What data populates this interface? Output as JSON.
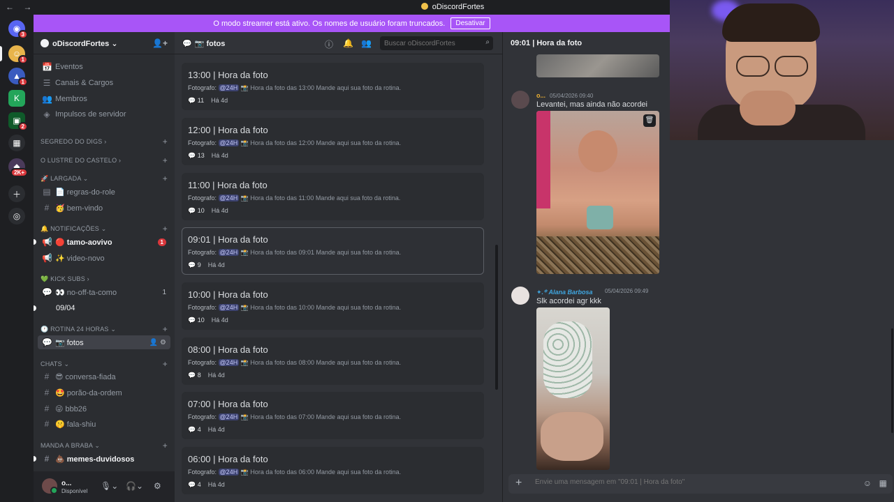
{
  "window": {
    "title": "oDiscordFortes",
    "back": "←",
    "forward": "→"
  },
  "banner": {
    "text": "O modo streamer está ativo. Os nomes de usuário foram truncados.",
    "button": "Desativar"
  },
  "servers": [
    {
      "badge": "3"
    },
    {
      "badge": "1"
    },
    {
      "badge": "1"
    },
    {
      "badge": ""
    },
    {
      "badge": "2"
    },
    {
      "badge": ""
    },
    {
      "badge": "2K+"
    }
  ],
  "sidebar": {
    "server_name": "oDiscordFortes",
    "items": [
      {
        "label": "Eventos",
        "icon": "📅"
      },
      {
        "label": "Canais & Cargos",
        "icon": "☰"
      },
      {
        "label": "Membros",
        "icon": "👥"
      },
      {
        "label": "Impulsos de servidor",
        "icon": "◈"
      }
    ],
    "categories": {
      "c1": "SEGREDO DO DIGS",
      "c2": "O LUSTRE DO CASTELO",
      "c3": "🚀 LARGADA",
      "c4": "🔔 NOTIFICAÇÕES",
      "c5": "💚 KICK SUBS",
      "c6": "🕐 ROTINA 24 HORAS",
      "c7": "CHATS",
      "c8": "MANDA A BRABA"
    },
    "channels": {
      "regras": "📄 regras-do-role",
      "bemvindo": "🥳 bem-vindo",
      "tamo": "🔴 tamo-aovivo",
      "tamo_count": "1",
      "video": "✨ video-novo",
      "nooff": "👀 no-off-ta-como",
      "nooff_count": "1",
      "thread": "09/04",
      "fotos": "📷 fotos",
      "conversa": "😎 conversa-fiada",
      "porao": "🤩 porão-da-ordem",
      "bbb": "😜 bbb26",
      "fala": "🤫 fala-shiu",
      "memes": "💩 memes-duvidosos"
    },
    "user": {
      "name": "o...",
      "status": "Disponível"
    }
  },
  "forum": {
    "title": "📷 fotos",
    "search_placeholder": "Buscar oDiscordFortes",
    "posts": [
      {
        "title": "13:00 | Hora da foto",
        "mention": "@24H",
        "preview": "📸 Hora da foto das 13:00 Mande aqui sua foto da rotina.",
        "count": "11",
        "age": "Há 4d"
      },
      {
        "title": "12:00 | Hora da foto",
        "mention": "@24H",
        "preview": "📸 Hora da foto das 12:00 Mande aqui sua foto da rotina.",
        "count": "13",
        "age": "Há 4d"
      },
      {
        "title": "11:00 | Hora da foto",
        "mention": "@24H",
        "preview": "📸 Hora da foto das 11:00 Mande aqui sua foto da rotina.",
        "count": "10",
        "age": "Há 4d"
      },
      {
        "title": "09:01 | Hora da foto",
        "mention": "@24H",
        "preview": "📸 Hora da foto das 09:01 Mande aqui sua foto da rotina.",
        "count": "9",
        "age": "Há 4d"
      },
      {
        "title": "10:00 | Hora da foto",
        "mention": "@24H",
        "preview": "📸 Hora da foto das 10:00 Mande aqui sua foto da rotina.",
        "count": "10",
        "age": "Há 4d"
      },
      {
        "title": "08:00 | Hora da foto",
        "mention": "@24H",
        "preview": "📸 Hora da foto das 08:00 Mande aqui sua foto da rotina.",
        "count": "8",
        "age": "Há 4d"
      },
      {
        "title": "07:00 | Hora da foto",
        "mention": "@24H",
        "preview": "📸 Hora da foto das 07:00 Mande aqui sua foto da rotina.",
        "count": "4",
        "age": "Há 4d"
      },
      {
        "title": "06:00 | Hora da foto",
        "mention": "@24H",
        "preview": "📸 Hora da foto das 06:00 Mande aqui sua foto da rotina.",
        "count": "4",
        "age": "Há 4d"
      }
    ],
    "author_label": "Fotografo:"
  },
  "thread": {
    "title": "09:01 | Hora da foto",
    "messages": [
      {
        "author": "o...",
        "time": "05/04/2026 09:40",
        "text": "Levantei, mas ainda não acordei"
      },
      {
        "author": "✦.꙳ Alana Barbosa",
        "time": "05/04/2026 09:49",
        "text": "Slk acordei agr kkk"
      }
    ],
    "composer_placeholder": "Envie uma mensagem em \"09:01 | Hora da foto\""
  },
  "colors": {
    "accent": "#a855f7",
    "blurple": "#5865f2",
    "red": "#da373c",
    "green": "#23a55a"
  }
}
